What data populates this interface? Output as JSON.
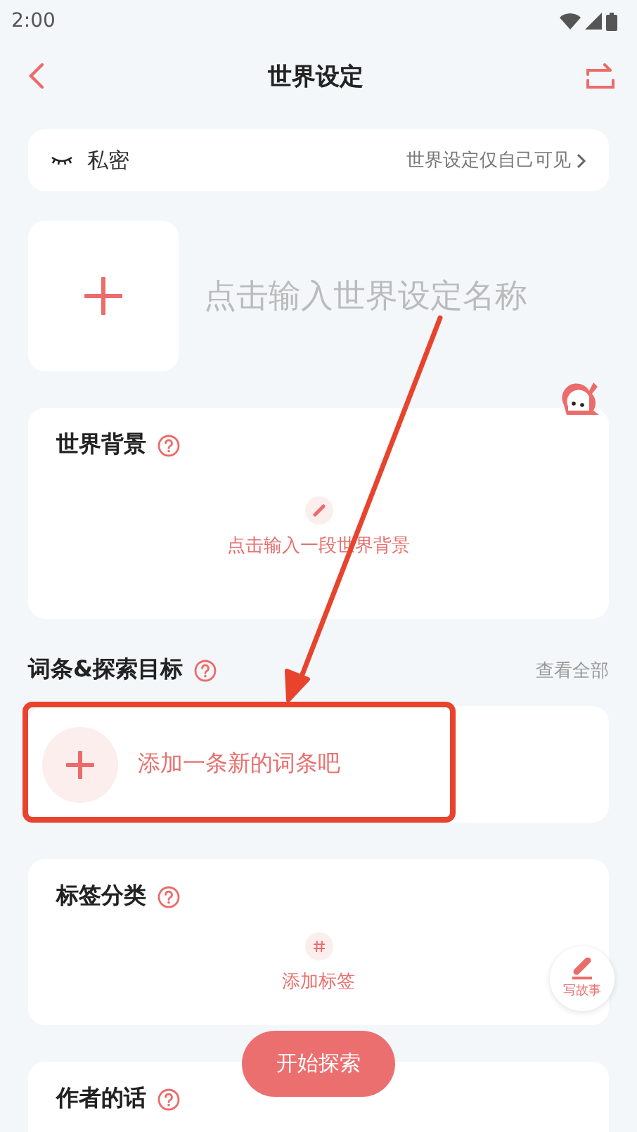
{
  "status_bar": {
    "time": "2:00"
  },
  "header": {
    "title": "世界设定"
  },
  "privacy": {
    "label": "私密",
    "hint": "世界设定仅自己可见"
  },
  "name_field": {
    "placeholder": "点击输入世界设定名称"
  },
  "world_background": {
    "title": "世界背景",
    "action": "点击输入一段世界背景"
  },
  "entries": {
    "title": "词条&探索目标",
    "link": "查看全部",
    "add_text": "添加一条新的词条吧"
  },
  "tags": {
    "title": "标签分类",
    "action": "添加标签"
  },
  "author_note": {
    "title": "作者的话"
  },
  "start_button": "开始探索",
  "write_button": "写故事"
}
